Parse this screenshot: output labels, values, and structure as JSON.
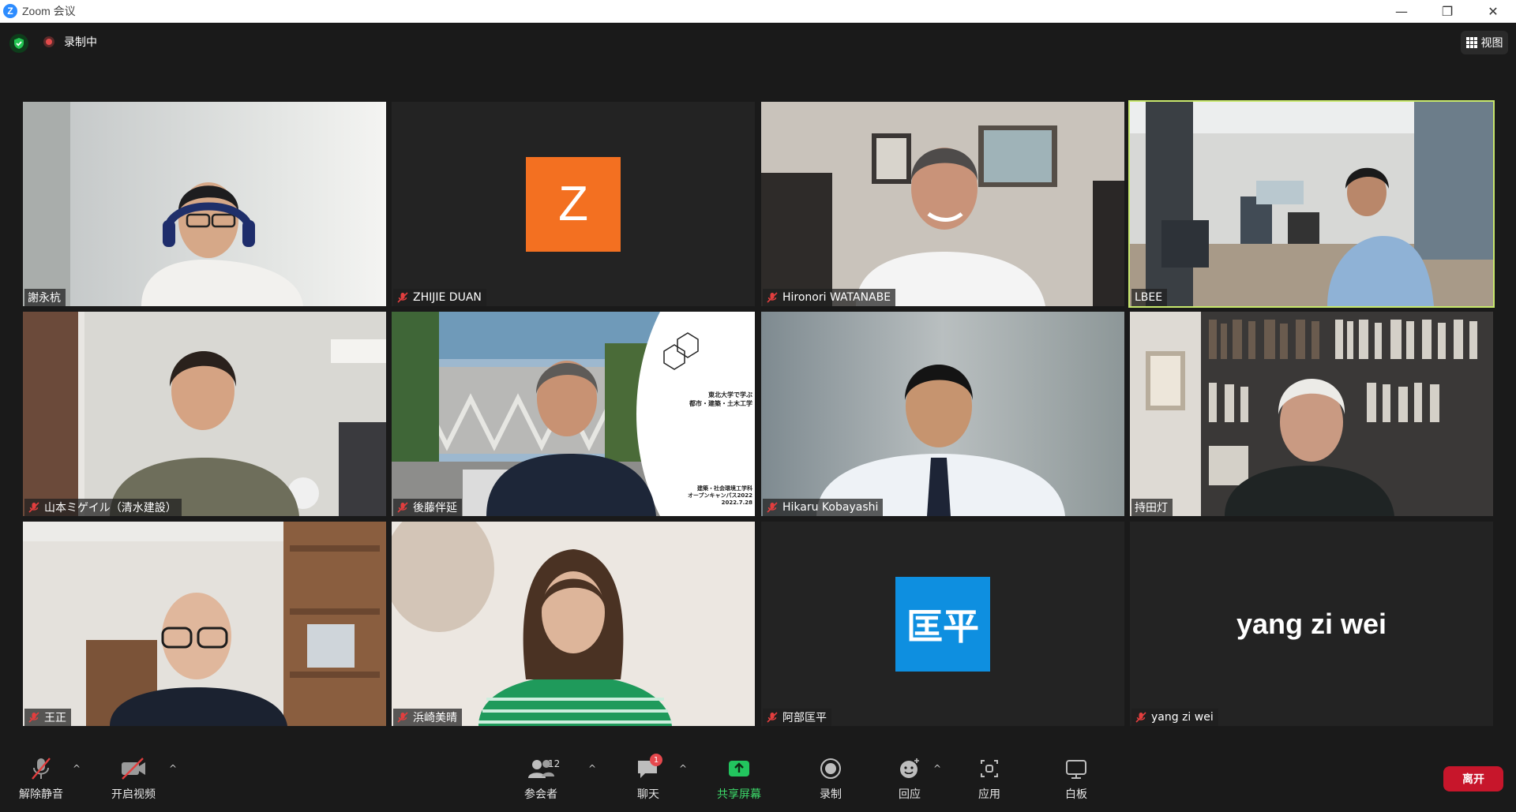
{
  "window": {
    "app_logo_letter": "Z",
    "title": "Zoom 会议",
    "minimize_glyph": "—",
    "restore_glyph": "❐",
    "close_glyph": "✕"
  },
  "topbar": {
    "security_icon": "shield-check-icon",
    "recording_label": "录制中",
    "view_label": "视图"
  },
  "participants": [
    {
      "name": "謝永杭",
      "muted": false,
      "video": true
    },
    {
      "name": "ZHIJIE DUAN",
      "muted": true,
      "video": false,
      "avatar_text": "Z",
      "avatar_color": "#f37021"
    },
    {
      "name": "Hironori WATANABE",
      "muted": true,
      "video": true
    },
    {
      "name": "LBEE",
      "muted": false,
      "video": true,
      "active_speaker": true
    },
    {
      "name": "山本ミゲイル（清水建設）",
      "muted": true,
      "video": true
    },
    {
      "name": "後藤伴延",
      "muted": true,
      "video": true,
      "slide_lines": [
        "東北大学で学ぶ",
        "都市・建築・土木工学",
        "建築・社会環境工学科",
        "オープンキャンパス2022",
        "2022.7.28"
      ]
    },
    {
      "name": "Hikaru Kobayashi",
      "muted": true,
      "video": true
    },
    {
      "name": "持田灯",
      "muted": false,
      "video": true
    },
    {
      "name": "王正",
      "muted": true,
      "video": true
    },
    {
      "name": "浜崎美晴",
      "muted": true,
      "video": true
    },
    {
      "name": "阿部匡平",
      "muted": true,
      "video": false,
      "avatar_text": "匡平",
      "avatar_color": "#0e8fe0"
    },
    {
      "name": "yang zi wei",
      "muted": true,
      "video": false,
      "display_text": "yang zi wei"
    }
  ],
  "toolbar": {
    "unmute_label": "解除静音",
    "start_video_label": "开启视频",
    "participants_label": "参会者",
    "participants_count": "12",
    "chat_label": "聊天",
    "chat_badge": "1",
    "share_label": "共享屏幕",
    "record_label": "录制",
    "reactions_label": "回应",
    "apps_label": "应用",
    "whiteboard_label": "白板",
    "leave_label": "离开",
    "caret_glyph": "^",
    "accent_share": "#3ddc6b",
    "leave_color": "#c7162b"
  }
}
